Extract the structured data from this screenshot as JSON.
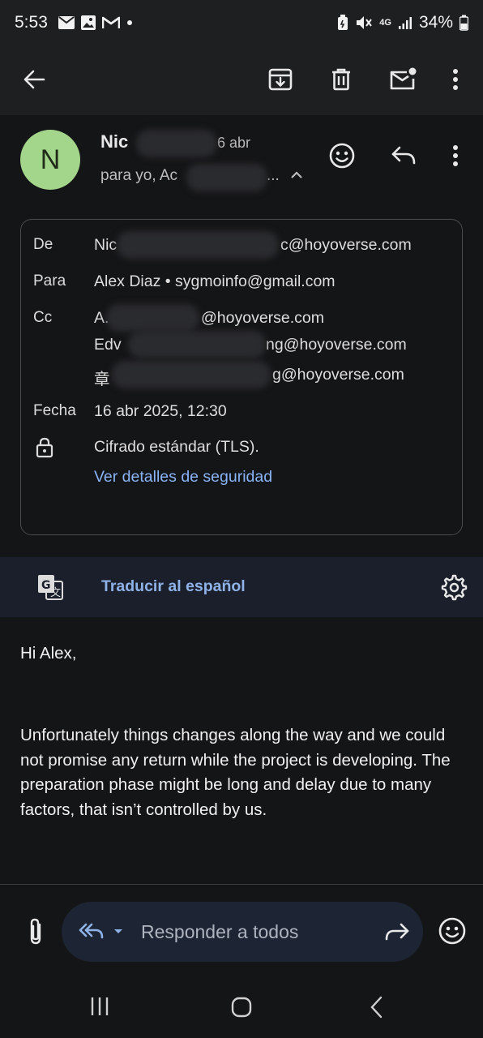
{
  "status_bar": {
    "time": "5:53",
    "network": "4G",
    "battery": "34%"
  },
  "toolbar": {
    "icons": [
      "back-arrow-icon",
      "archive-icon",
      "delete-icon",
      "mark-unread-icon",
      "more-vert-icon"
    ]
  },
  "header": {
    "avatar_letter": "N",
    "sender_name": "Nic",
    "date_partial": "6 abr",
    "recipients_summary": "para yo, Ac",
    "recipients_ellipsis": "...",
    "avatar_color": "#a3d58a"
  },
  "details": {
    "from_label": "De",
    "from_value_start": "Nic",
    "from_value_end": "c@hoyoverse.com",
    "to_label": "Para",
    "to_value": "Alex Diaz • sygmoinfo@gmail.com",
    "cc_label": "Cc",
    "cc_1_start": "A.",
    "cc_1_end": "@hoyoverse.com",
    "cc_2_start": "Edv",
    "cc_2_end": "ng@hoyoverse.com",
    "cc_3_start": "章",
    "cc_3_end": "g@hoyoverse.com",
    "date_label": "Fecha",
    "date_value": "16 abr 2025, 12:30",
    "encryption_text": "Cifrado estándar (TLS).",
    "security_link": "Ver detalles de seguridad"
  },
  "translate": {
    "label": "Traducir al español"
  },
  "message": {
    "greeting": "Hi Alex,",
    "paragraph": "Unfortunately things changes along the way and we could not promise any return while the project is developing. The preparation phase might be long and delay due to many factors, that isn’t controlled by us."
  },
  "reply_bar": {
    "placeholder": "Responder a todos"
  },
  "colors": {
    "background": "#141517",
    "link": "#8ab4f8",
    "reply_pill": "#1d2433"
  }
}
